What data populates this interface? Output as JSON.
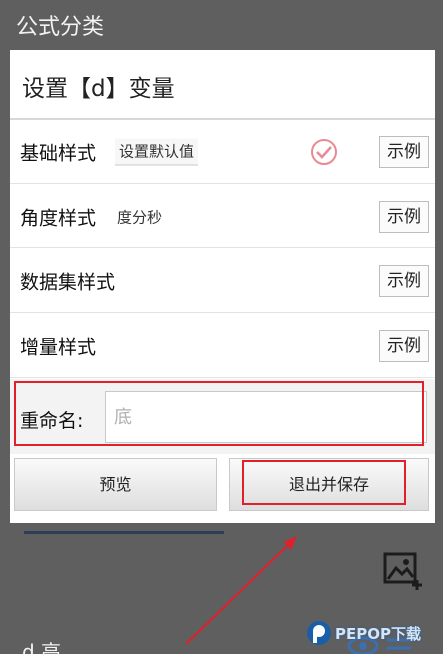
{
  "background": {
    "title": "公式分类",
    "bottom_text": "d 高"
  },
  "watermark": {
    "text": "PEPOP下载"
  },
  "dialog": {
    "title": "设置【d】变量",
    "rows": [
      {
        "label": "基础样式",
        "value": "设置默认值",
        "checked": true,
        "example": "示例"
      },
      {
        "label": "角度样式",
        "value": "度分秒",
        "example": "示例"
      },
      {
        "label": "数据集样式",
        "value": "",
        "example": "示例"
      },
      {
        "label": "增量样式",
        "value": "",
        "example": "示例"
      }
    ],
    "rename": {
      "label": "重命名:",
      "placeholder": "底"
    },
    "buttons": {
      "preview": "预览",
      "save": "退出并保存"
    }
  },
  "colors": {
    "highlight": "#e21f2b",
    "overlay": "#5f5f5f",
    "check": "#e88a93"
  }
}
